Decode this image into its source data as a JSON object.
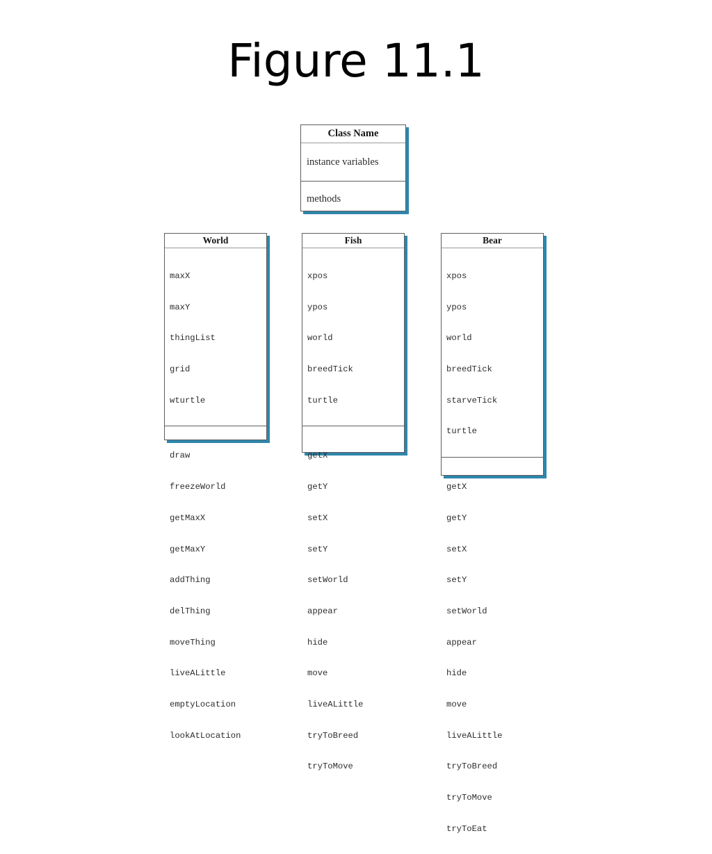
{
  "slide": {
    "title": "Figure 11.1",
    "background_color": "#ffffff",
    "shadow_color": "#2e86ab",
    "border_color": "#5d5d5d"
  },
  "diagram": {
    "type": "uml-class-diagram",
    "template_box": {
      "header": "Class Name",
      "attributes_label": "instance variables",
      "methods_label": "methods"
    },
    "classes": [
      {
        "name": "World",
        "attributes": [
          "maxX",
          "maxY",
          "thingList",
          "grid",
          "wturtle"
        ],
        "methods": [
          "draw",
          "freezeWorld",
          "getMaxX",
          "getMaxY",
          "addThing",
          "delThing",
          "moveThing",
          "liveALittle",
          "emptyLocation",
          "lookAtLocation"
        ]
      },
      {
        "name": "Fish",
        "attributes": [
          "xpos",
          "ypos",
          "world",
          "breedTick",
          "turtle"
        ],
        "methods": [
          "getX",
          "getY",
          "setX",
          "setY",
          "setWorld",
          "appear",
          "hide",
          "move",
          "liveALittle",
          "tryToBreed",
          "tryToMove"
        ]
      },
      {
        "name": "Bear",
        "attributes": [
          "xpos",
          "ypos",
          "world",
          "breedTick",
          "starveTick",
          "turtle"
        ],
        "methods": [
          "getX",
          "getY",
          "setX",
          "setY",
          "setWorld",
          "appear",
          "hide",
          "move",
          "liveALittle",
          "tryToBreed",
          "tryToMove",
          "tryToEat"
        ]
      }
    ]
  }
}
